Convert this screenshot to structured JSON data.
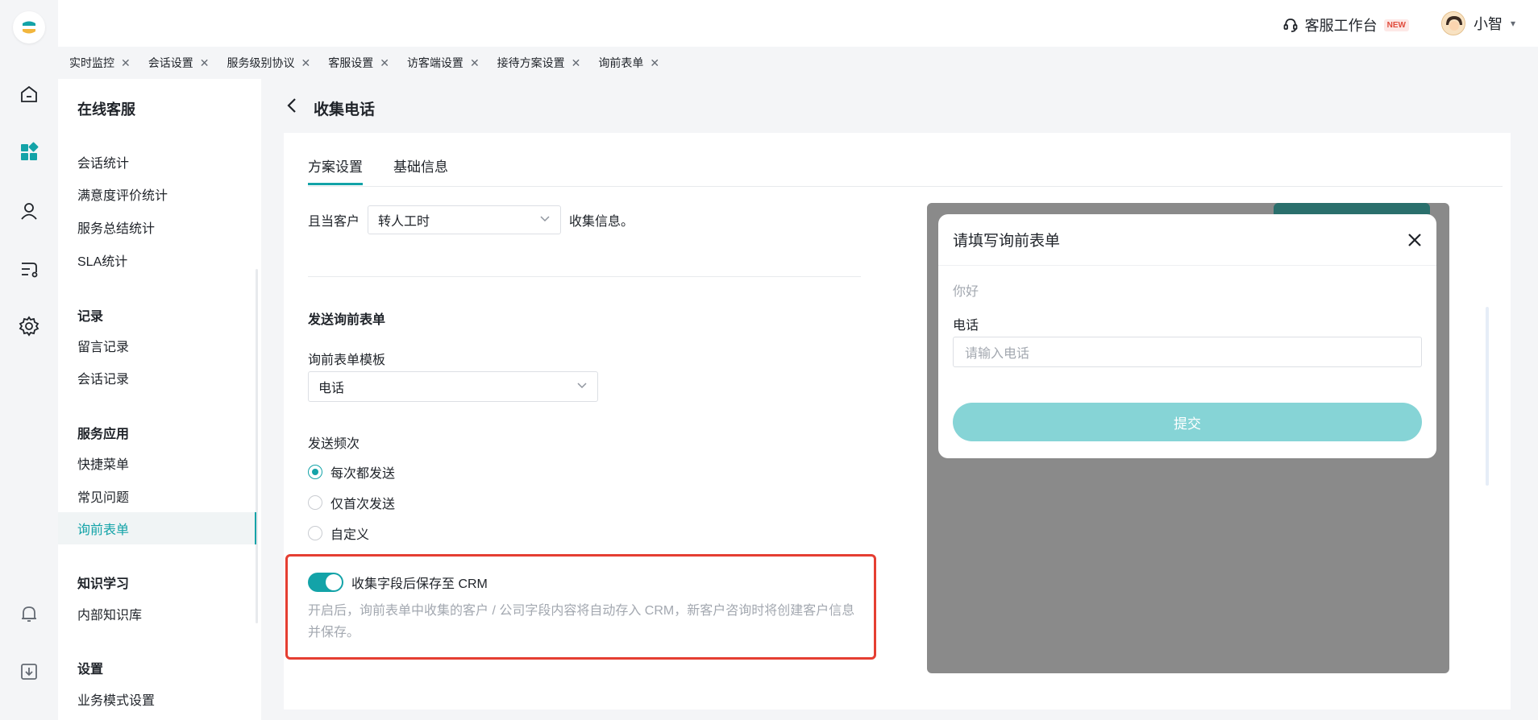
{
  "header": {
    "workbench_label": "客服工作台",
    "new_badge": "NEW",
    "user_name": "小智"
  },
  "tabs": [
    {
      "label": "实时监控"
    },
    {
      "label": "会话设置"
    },
    {
      "label": "服务级别协议"
    },
    {
      "label": "客服设置"
    },
    {
      "label": "访客端设置"
    },
    {
      "label": "接待方案设置"
    },
    {
      "label": "询前表单"
    }
  ],
  "sidebar": {
    "title": "在线客服",
    "items_stats": [
      "会话统计",
      "满意度评价统计",
      "服务总结统计",
      "SLA统计"
    ],
    "group_records": "记录",
    "items_records": [
      "留言记录",
      "会话记录"
    ],
    "group_apps": "服务应用",
    "items_apps": [
      "快捷菜单",
      "常见问题",
      "询前表单"
    ],
    "active_item": "询前表单",
    "group_knowledge": "知识学习",
    "items_knowledge": [
      "内部知识库"
    ],
    "group_settings": "设置",
    "items_settings": [
      "业务模式设置"
    ]
  },
  "page": {
    "title": "收集电话",
    "content_tabs": [
      "方案设置",
      "基础信息"
    ],
    "active_tab": "方案设置",
    "condition_prefix": "且当客户",
    "condition_select": "转人工时",
    "condition_suffix": "收集信息。",
    "section_send": "发送询前表单",
    "template_label": "询前表单模板",
    "template_value": "电话",
    "frequency_label": "发送频次",
    "frequency_options": [
      "每次都发送",
      "仅首次发送",
      "自定义"
    ],
    "frequency_selected": "每次都发送",
    "crm_toggle_label": "收集字段后保存至 CRM",
    "crm_toggle_on": true,
    "crm_help": "开启后，询前表单中收集的客户 / 公司字段内容将自动存入 CRM，新客户咨询时将创建客户信息并保存。"
  },
  "preview": {
    "modal_title": "请填写询前表单",
    "greeting": "你好",
    "field_label": "电话",
    "field_placeholder": "请输入电话",
    "submit_label": "提交"
  },
  "colors": {
    "accent": "#13a3a8",
    "highlight_border": "#e53e32",
    "submit_bg": "#86d4d6"
  }
}
